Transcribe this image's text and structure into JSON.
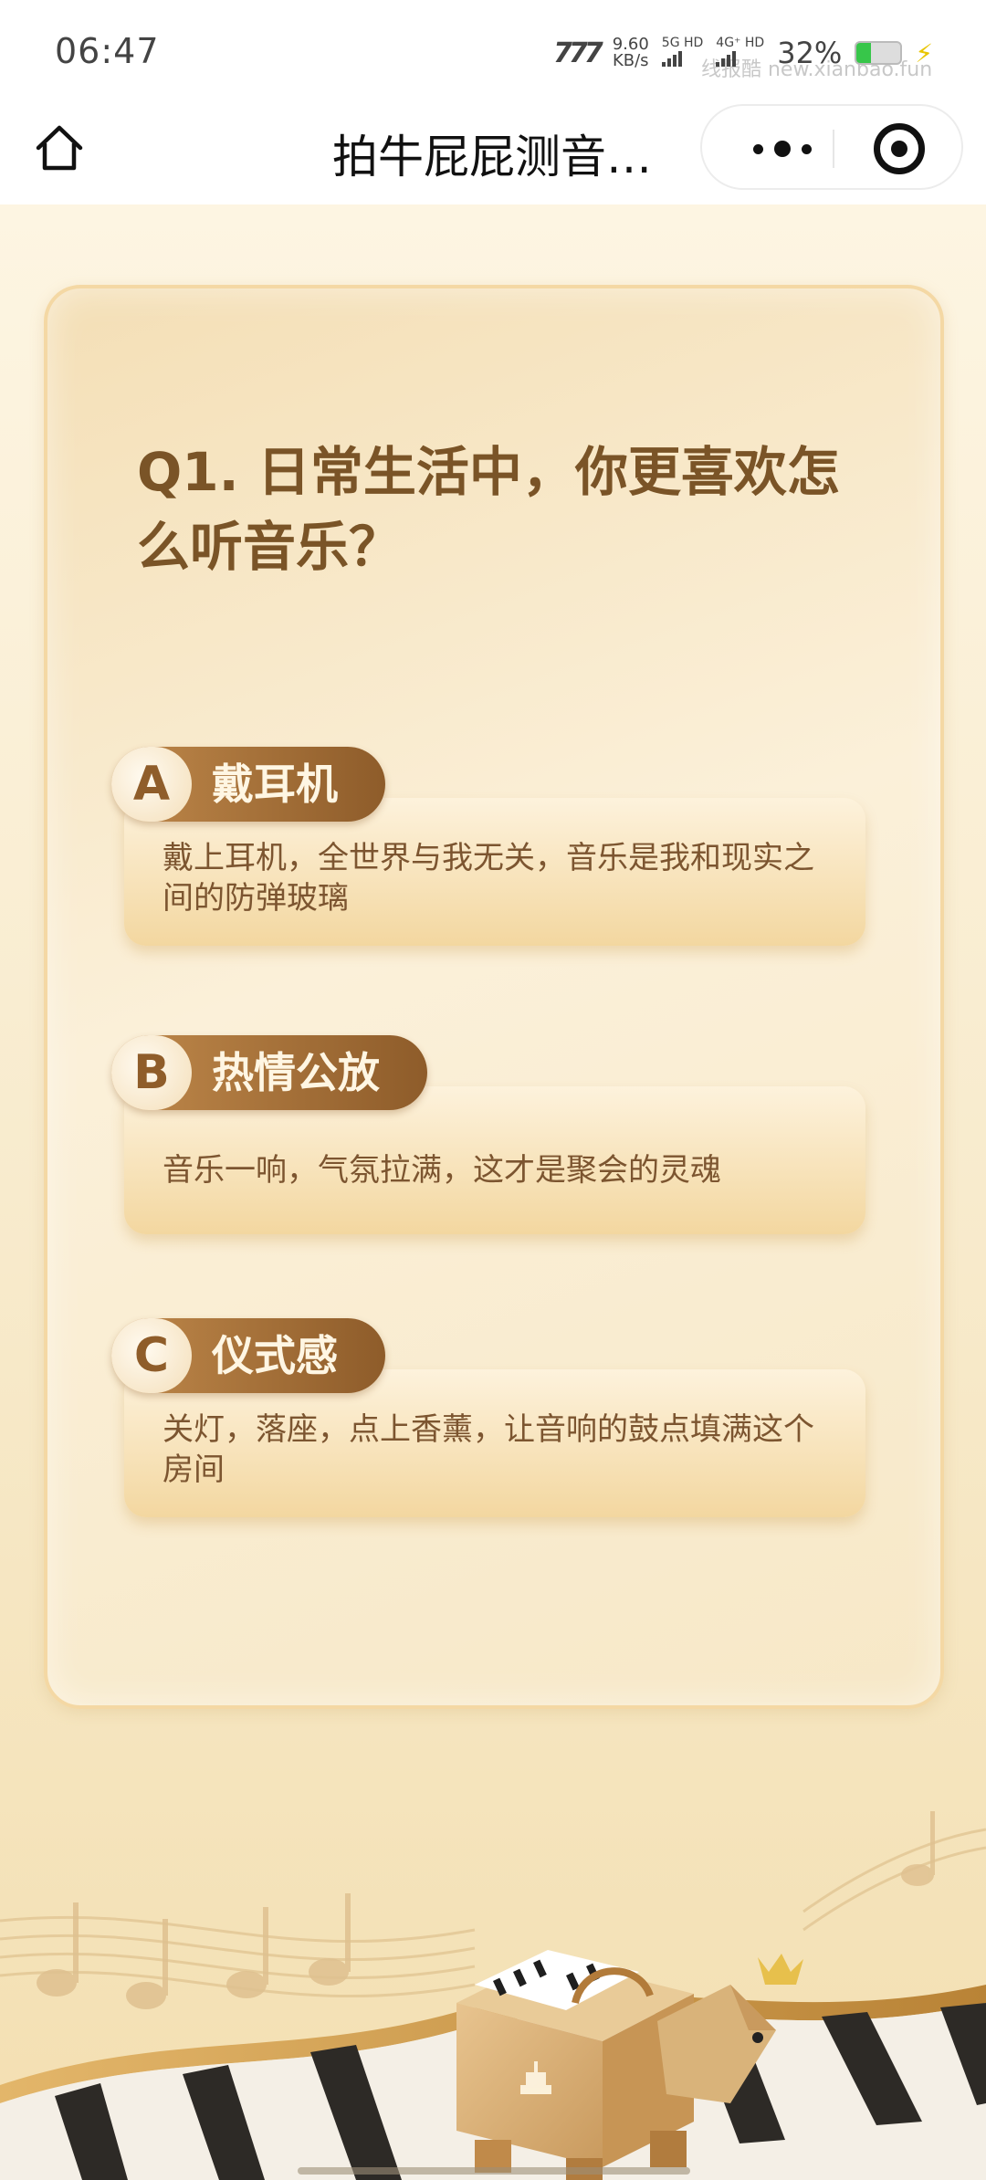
{
  "status_bar": {
    "time": "06:47",
    "net_speed_value": "9.60",
    "net_speed_unit": "KB/s",
    "sim1": "5G HD",
    "sim2": "4G⁺ HD",
    "battery_percent": "32%",
    "battery_level": 0.32,
    "watermark": "线报酷 new.xianbao.fun"
  },
  "nav": {
    "title": "拍牛屁屁测音…"
  },
  "quiz": {
    "question": "Q1. 日常生活中，你更喜欢怎么听音乐？",
    "options": [
      {
        "letter": "A",
        "title": "戴耳机",
        "desc": "戴上耳机，全世界与我无关，音乐是我和现实之间的防弹玻璃"
      },
      {
        "letter": "B",
        "title": "热情公放",
        "desc": "音乐一响，气氛拉满，这才是聚会的灵魂"
      },
      {
        "letter": "C",
        "title": "仪式感",
        "desc": "关灯，落座，点上香薰，让音响的鼓点填满这个房间"
      }
    ]
  },
  "colors": {
    "accent": "#8e5c2a",
    "background": "#f6e9c9",
    "battery": "#37c64a"
  }
}
